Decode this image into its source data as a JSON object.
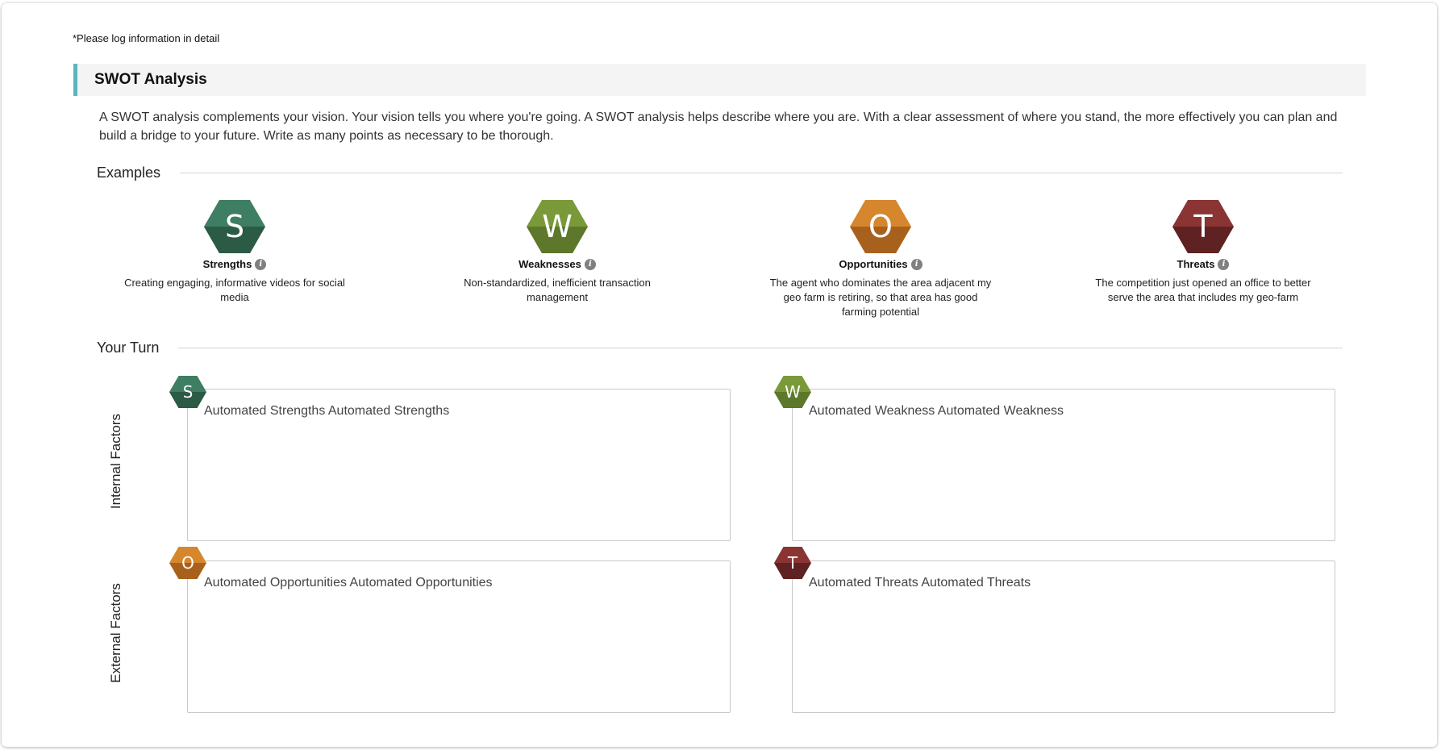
{
  "note": "*Please log information in detail",
  "section": {
    "title": "SWOT Analysis",
    "intro": "A SWOT analysis complements your vision. Your vision tells you where you're going. A SWOT analysis helps describe where you are. With a clear assessment of where you stand, the more effectively you can plan and build a bridge to your future. Write as many points as necessary to be thorough."
  },
  "examples": {
    "heading": "Examples",
    "items": [
      {
        "letter": "S",
        "title": "Strengths",
        "description": "Creating engaging, informative videos for social media",
        "color_top": "#3e7e63",
        "color_bottom": "#2b5a45",
        "icon": "info-icon"
      },
      {
        "letter": "W",
        "title": "Weaknesses",
        "description": "Non-standardized, inefficient transaction management",
        "color_top": "#7a9a3a",
        "color_bottom": "#5d772b",
        "icon": "info-icon"
      },
      {
        "letter": "O",
        "title": "Opportunities",
        "description": "The agent who dominates the area adjacent my geo farm is retiring, so that area has good farming potential",
        "color_top": "#d6872d",
        "color_bottom": "#a8611c",
        "icon": "info-icon"
      },
      {
        "letter": "T",
        "title": "Threats",
        "description": "The competition just opened an office to better serve the area that includes my geo-farm",
        "color_top": "#8a3434",
        "color_bottom": "#5e2222",
        "icon": "info-icon"
      }
    ]
  },
  "your_turn": {
    "heading": "Your Turn",
    "internal_label": "Internal Factors",
    "external_label": "External Factors",
    "boxes": [
      {
        "letter": "S",
        "value": "Automated Strengths Automated Strengths"
      },
      {
        "letter": "W",
        "value": "Automated Weakness Automated Weakness"
      },
      {
        "letter": "O",
        "value": "Automated Opportunities Automated Opportunities"
      },
      {
        "letter": "T",
        "value": "Automated Threats Automated Threats"
      }
    ]
  },
  "colors": {
    "accent": "#5bb5bd",
    "header_bg": "#f4f4f4"
  }
}
